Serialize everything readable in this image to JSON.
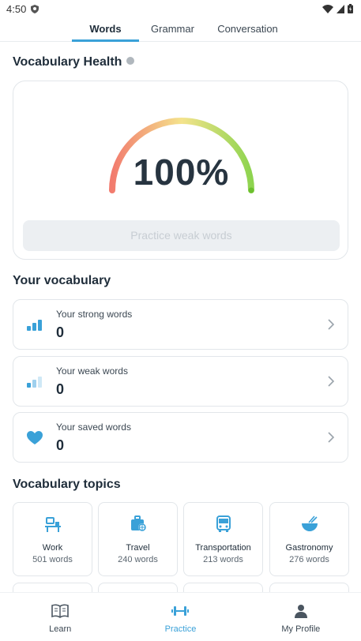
{
  "status_bar": {
    "time": "4:50"
  },
  "tabs": [
    {
      "label": "Words",
      "active": true
    },
    {
      "label": "Grammar",
      "active": false
    },
    {
      "label": "Conversation",
      "active": false
    }
  ],
  "health": {
    "title": "Vocabulary Health",
    "value_text": "100%",
    "level_fraction": 1.0,
    "practice_button_label": "Practice weak words"
  },
  "vocabulary": {
    "title": "Your vocabulary",
    "items": [
      {
        "label": "Your strong words",
        "count": "0",
        "icon": "strong-bars-icon"
      },
      {
        "label": "Your weak words",
        "count": "0",
        "icon": "weak-bars-icon"
      },
      {
        "label": "Your saved words",
        "count": "0",
        "icon": "heart-icon"
      }
    ]
  },
  "topics": {
    "title": "Vocabulary topics",
    "items": [
      {
        "name": "Work",
        "count": "501 words",
        "icon": "work-desk-icon"
      },
      {
        "name": "Travel",
        "count": "240 words",
        "icon": "luggage-icon"
      },
      {
        "name": "Transportation",
        "count": "213 words",
        "icon": "bus-icon"
      },
      {
        "name": "Gastronomy",
        "count": "276 words",
        "icon": "bowl-chopsticks-icon"
      }
    ]
  },
  "bottom_nav": [
    {
      "label": "Learn",
      "icon": "book-icon",
      "active": false
    },
    {
      "label": "Practice",
      "icon": "dumbbell-icon",
      "active": true
    },
    {
      "label": "My Profile",
      "icon": "person-icon",
      "active": false
    }
  ],
  "colors": {
    "accent": "#3aa1d8",
    "gauge_start": "#f27b6e",
    "gauge_mid": "#f4e38c",
    "gauge_end": "#8ed44f"
  }
}
